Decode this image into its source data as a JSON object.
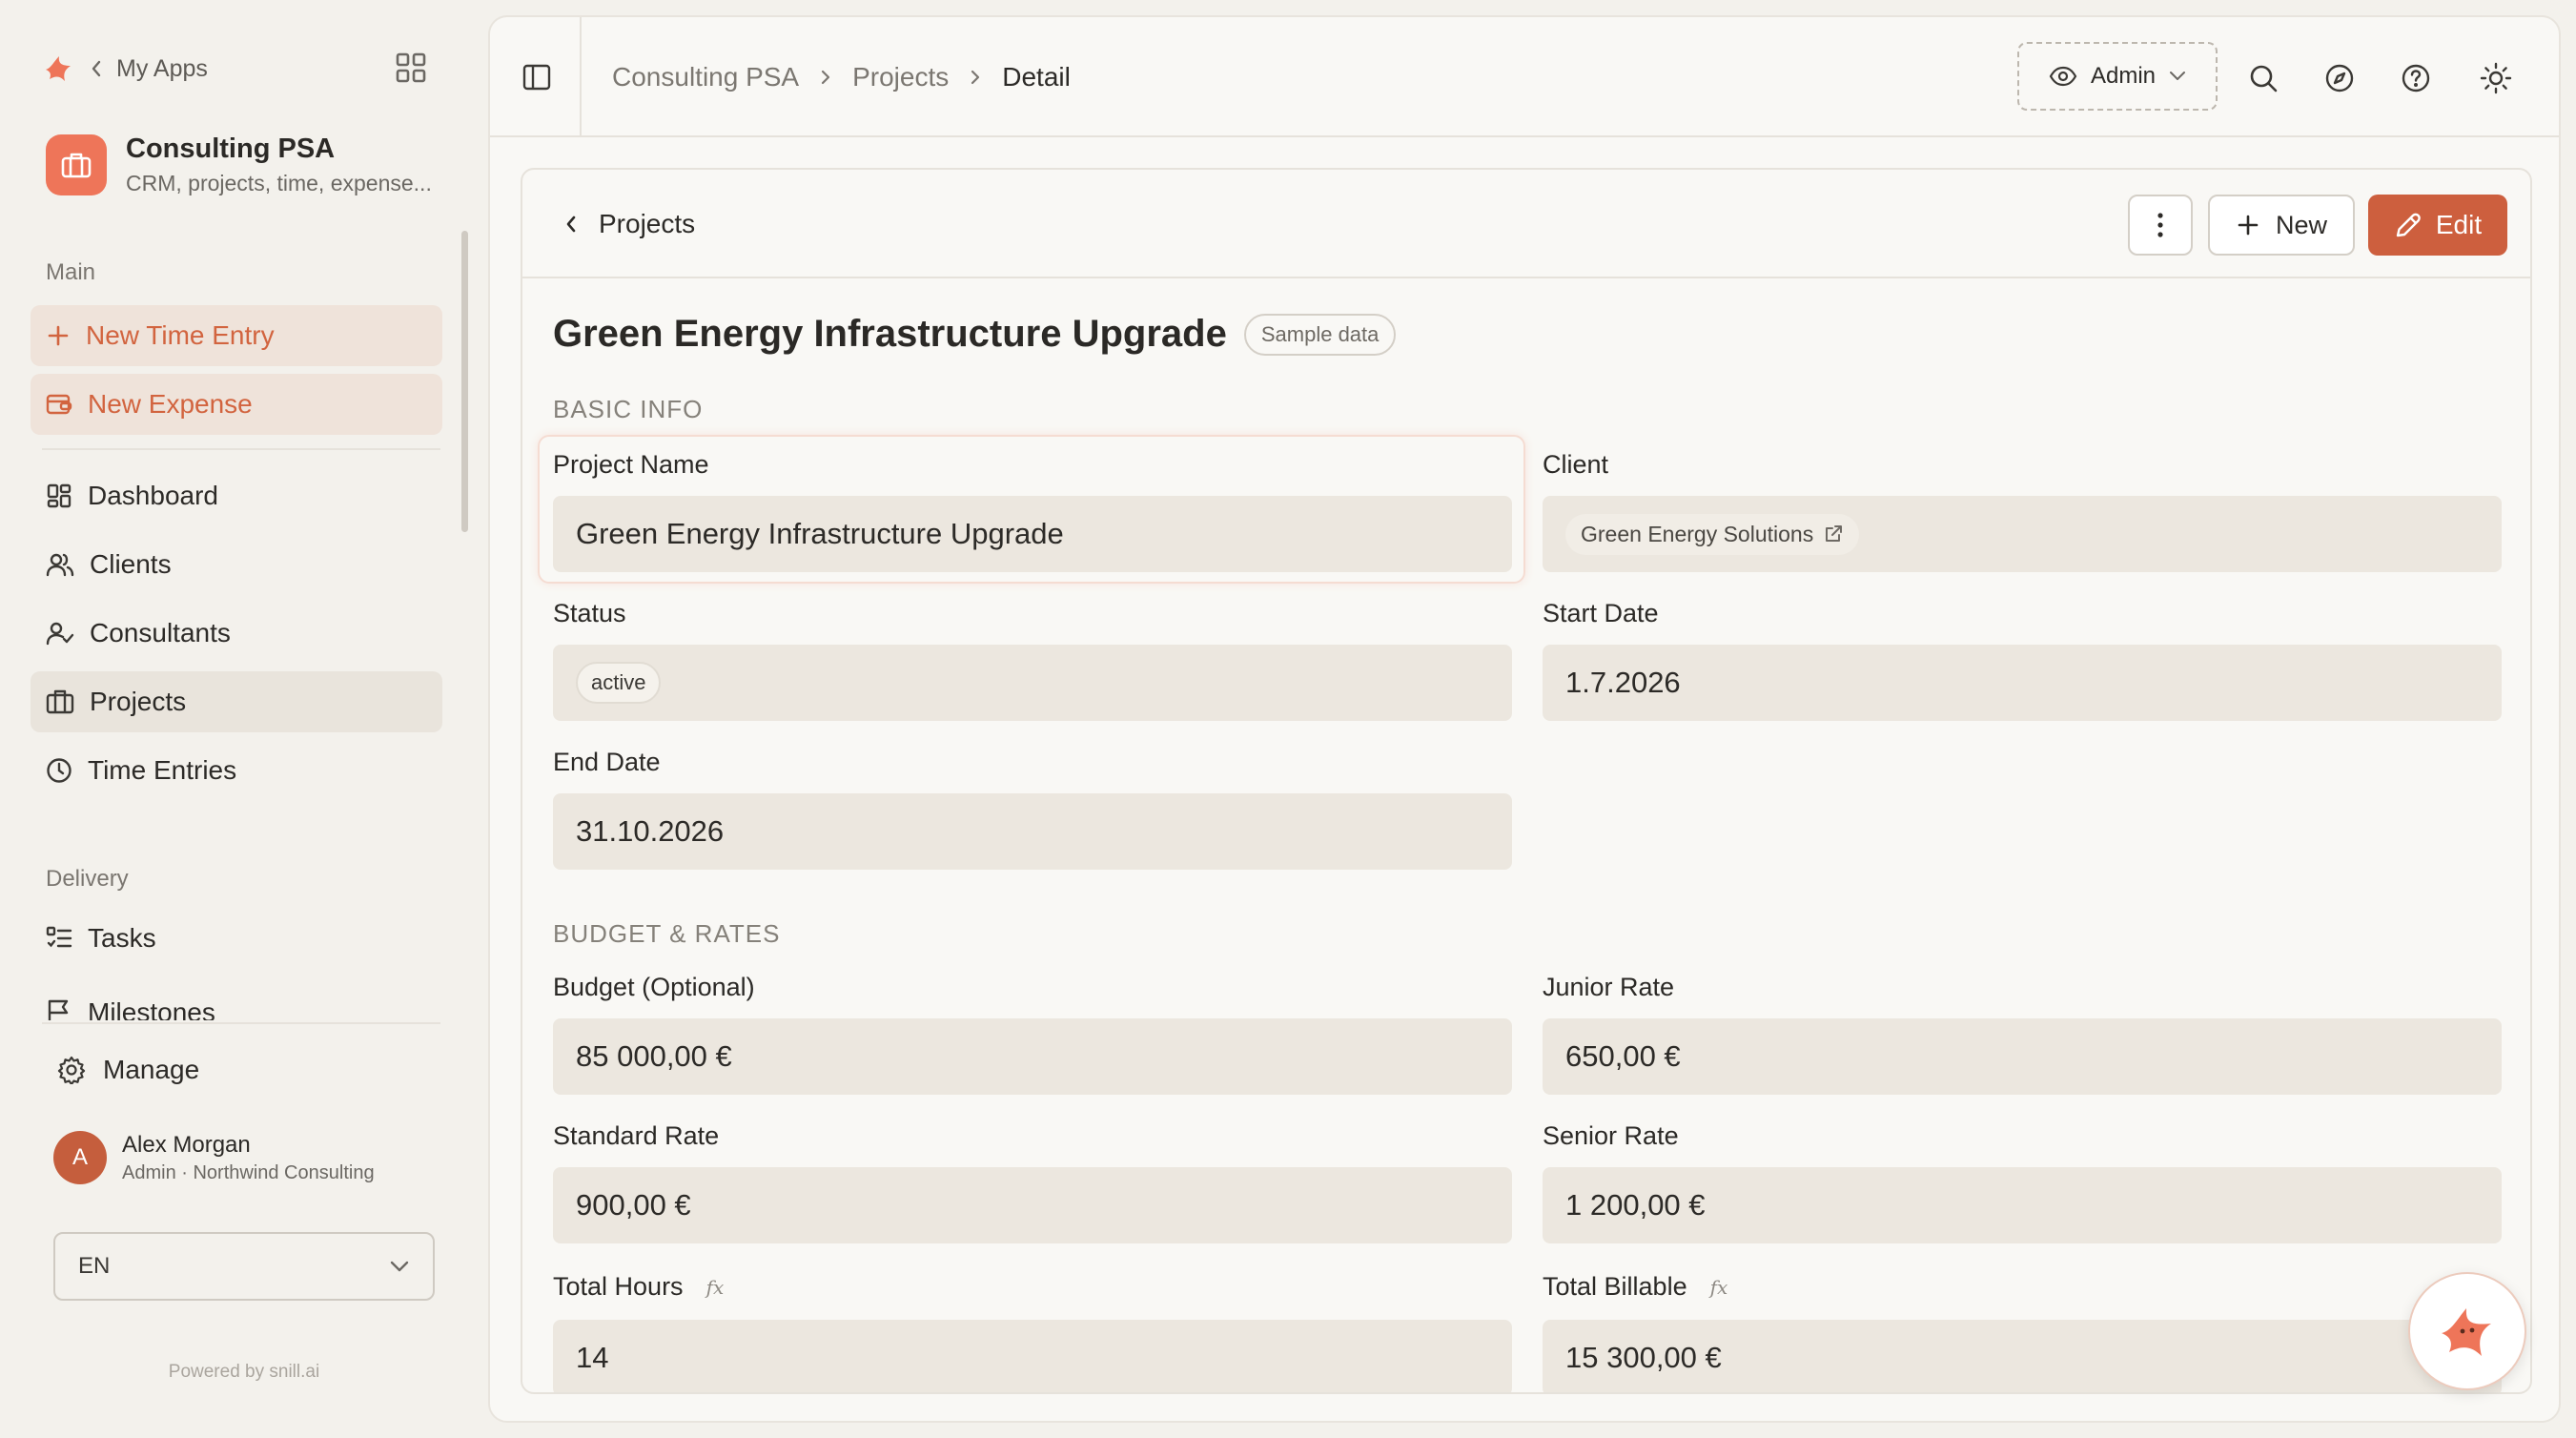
{
  "nav_top": {
    "back_label": "My Apps"
  },
  "app": {
    "name": "Consulting PSA",
    "description": "CRM, projects, time, expense..."
  },
  "sidebar": {
    "main_label": "Main",
    "quick_actions": [
      {
        "label": "New Time Entry",
        "icon": "plus-icon"
      },
      {
        "label": "New Expense",
        "icon": "receipt-icon"
      }
    ],
    "items": [
      {
        "label": "Dashboard",
        "icon": "dashboard-icon"
      },
      {
        "label": "Clients",
        "icon": "users-icon"
      },
      {
        "label": "Consultants",
        "icon": "user-check-icon"
      },
      {
        "label": "Projects",
        "icon": "briefcase-icon",
        "active": true
      },
      {
        "label": "Time Entries",
        "icon": "clock-icon"
      }
    ],
    "delivery_label": "Delivery",
    "delivery_items": [
      {
        "label": "Tasks",
        "icon": "list-checks-icon"
      },
      {
        "label": "Milestones",
        "icon": "flag-icon"
      }
    ],
    "manage_label": "Manage",
    "user": {
      "initial": "A",
      "name": "Alex Morgan",
      "role": "Admin · Northwind Consulting"
    },
    "language": "EN",
    "powered_by": "Powered by snill.ai"
  },
  "topbar": {
    "breadcrumb": [
      "Consulting PSA",
      "Projects",
      "Detail"
    ],
    "role_label": "Admin"
  },
  "card": {
    "back_label": "Projects",
    "new_label": "New",
    "edit_label": "Edit",
    "title": "Green Energy Infrastructure Upgrade",
    "badge": "Sample data",
    "sections": {
      "basic": "BASIC INFO",
      "budget": "BUDGET & RATES"
    },
    "fields": {
      "project_name": {
        "label": "Project Name",
        "value": "Green Energy Infrastructure Upgrade"
      },
      "client": {
        "label": "Client",
        "value": "Green Energy Solutions"
      },
      "status": {
        "label": "Status",
        "value": "active"
      },
      "start_date": {
        "label": "Start Date",
        "value": "1.7.2026"
      },
      "end_date": {
        "label": "End Date",
        "value": "31.10.2026"
      },
      "budget": {
        "label": "Budget (Optional)",
        "value": "85 000,00 €"
      },
      "junior_rate": {
        "label": "Junior Rate",
        "value": "650,00 €"
      },
      "standard_rate": {
        "label": "Standard Rate",
        "value": "900,00 €"
      },
      "senior_rate": {
        "label": "Senior Rate",
        "value": "1 200,00 €"
      },
      "total_hours": {
        "label": "Total Hours",
        "value": "14",
        "formula_marker": "fx"
      },
      "total_billable": {
        "label": "Total Billable",
        "value": "15 300,00 €",
        "formula_marker": "fx"
      }
    }
  },
  "colors": {
    "accent": "#cd5f3e",
    "brand": "#ee7559",
    "field_bg": "#ece7df",
    "page_bg": "#f3f1ec"
  }
}
